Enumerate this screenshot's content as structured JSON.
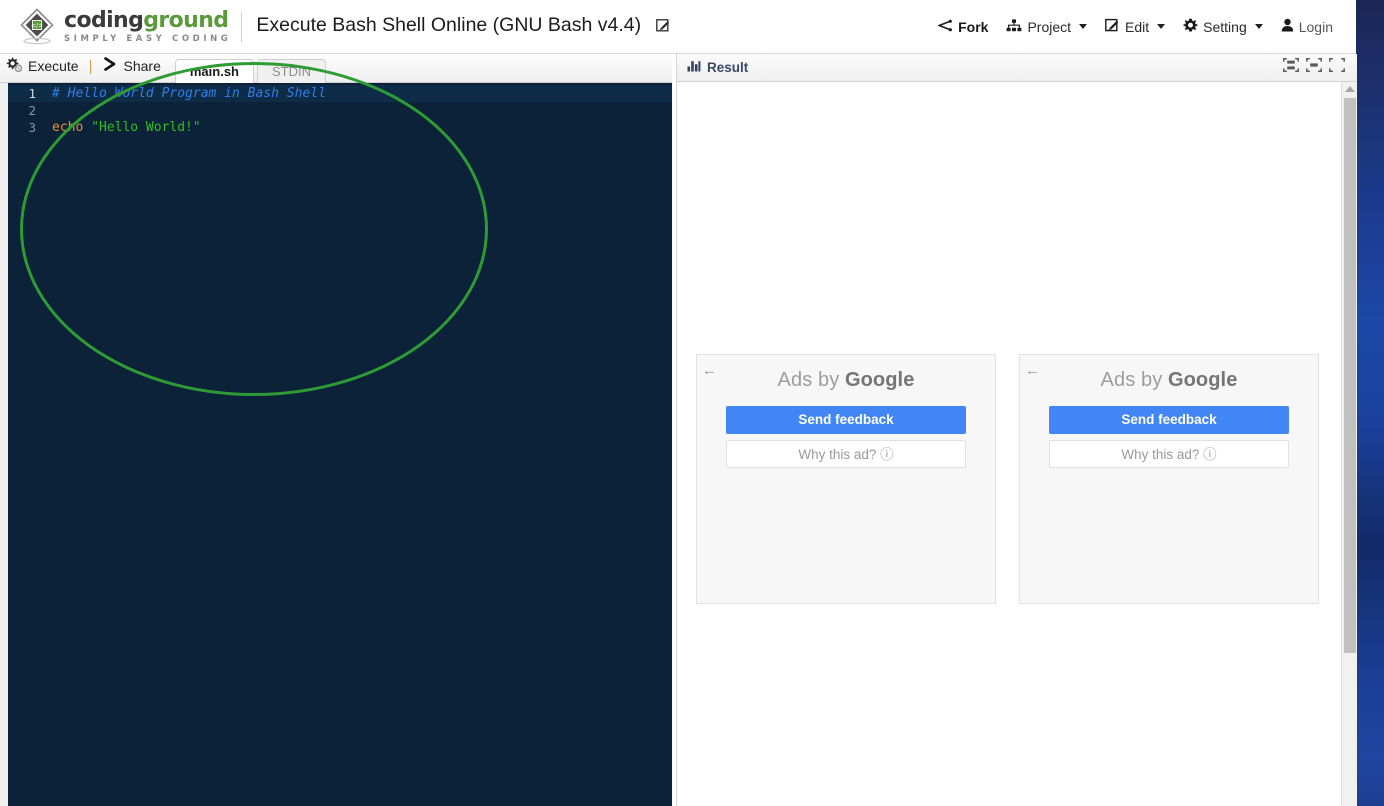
{
  "header": {
    "logo": {
      "word1": "coding",
      "word2": "ground",
      "tagline": "SIMPLY EASY CODING",
      "icon": "diamond-logo-icon"
    },
    "title": "Execute Bash Shell Online (GNU Bash v4.4)",
    "title_edit_icon": "edit-pencil-icon",
    "menu": [
      {
        "label": "Fork",
        "icon": "fork-icon",
        "has_caret": false,
        "bold": true
      },
      {
        "label": "Project",
        "icon": "project-sitemap-icon",
        "has_caret": true,
        "bold": false
      },
      {
        "label": "Edit",
        "icon": "edit-pencil-icon",
        "has_caret": true,
        "bold": false
      },
      {
        "label": "Setting",
        "icon": "gear-icon",
        "has_caret": true,
        "bold": false
      },
      {
        "label": "Login",
        "icon": "user-icon",
        "has_caret": false,
        "bold": false
      }
    ]
  },
  "editor": {
    "toolbar": {
      "execute_label": "Execute",
      "execute_icon": "gears-icon",
      "separator": "|",
      "share_label": "Share",
      "share_icon": "share-arrow-icon"
    },
    "tabs": [
      {
        "label": "main.sh",
        "active": true
      },
      {
        "label": "STDIN",
        "active": false
      }
    ],
    "line_numbers": [
      "1",
      "2",
      "3"
    ],
    "code": {
      "line1_comment": "# Hello World Program in Bash Shell",
      "line2": "",
      "line3_keyword": "echo",
      "line3_string": "\"Hello World!\""
    },
    "colors": {
      "background": "#0b2239",
      "active_line": "#0e2c47",
      "comment": "#2f7fe8",
      "keyword": "#e8902e",
      "string": "#2fbf1f",
      "gutter_text": "#8796a5"
    }
  },
  "result": {
    "title": "Result",
    "title_icon": "bar-chart-icon",
    "panel_icons": [
      "layout-split-horizontal-icon",
      "layout-single-pane-icon",
      "layout-maximize-icon"
    ],
    "output_text": ""
  },
  "ads": [
    {
      "back_arrow": "←",
      "title_prefix": "Ads by ",
      "title_brand": "Google",
      "primary_button": "Send feedback",
      "secondary_button": "Why this ad? ⓘ"
    },
    {
      "back_arrow": "←",
      "title_prefix": "Ads by ",
      "title_brand": "Google",
      "primary_button": "Send feedback",
      "secondary_button": "Why this ad? ⓘ"
    }
  ],
  "annotation": {
    "shape": "ellipse",
    "color": "#2e9b34"
  }
}
